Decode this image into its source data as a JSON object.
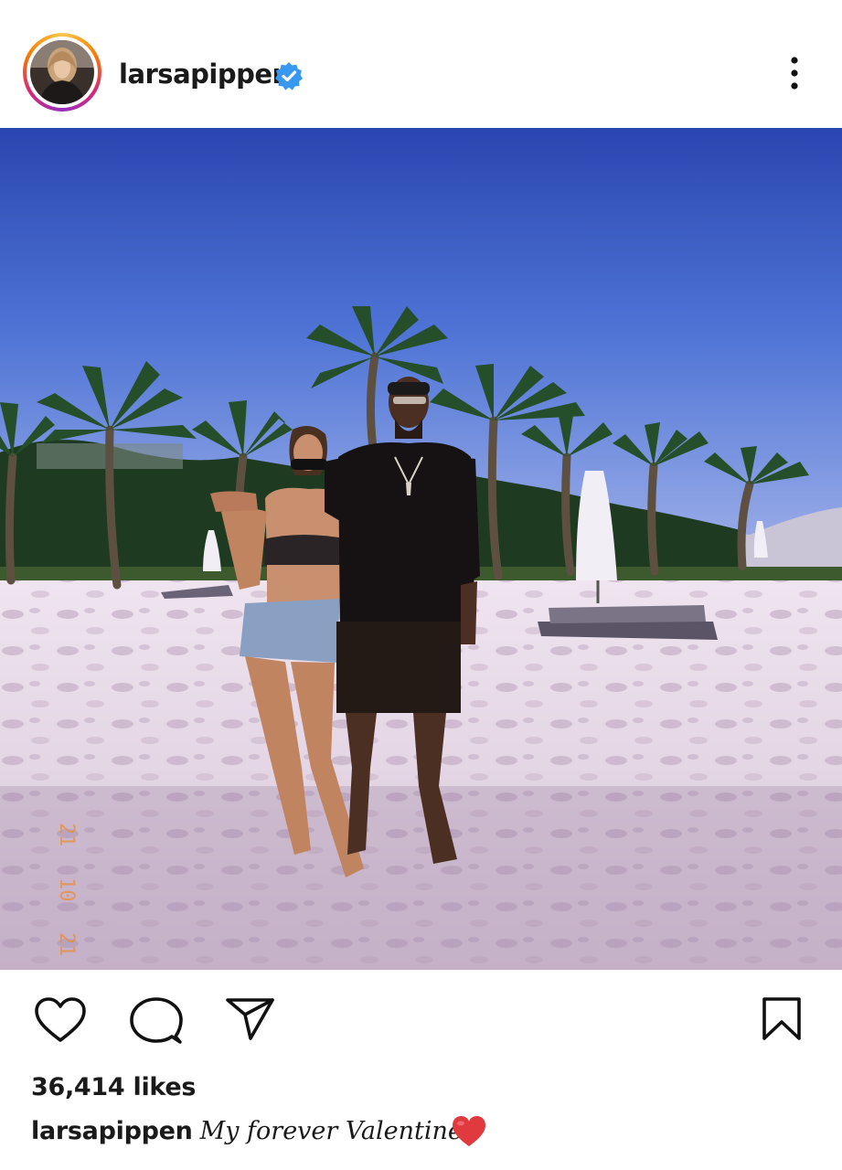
{
  "post": {
    "username": "larsapippen",
    "verified": true,
    "likes": "36,414 likes",
    "caption_user": "larsapippen",
    "caption_text": "My forever Valentine",
    "caption_emoji": "red-heart-emoji"
  },
  "icons": {
    "verified": "verified-badge-icon",
    "more": "more-options-icon",
    "like": "heart-icon",
    "comment": "comment-icon",
    "share": "share-icon",
    "save": "bookmark-icon"
  },
  "colors": {
    "verified": "#3897f0",
    "sky_top": "#2b4db5",
    "sky_bottom": "#8fa6e8",
    "sand": "#e9dcea",
    "heart": "#e0393e"
  }
}
